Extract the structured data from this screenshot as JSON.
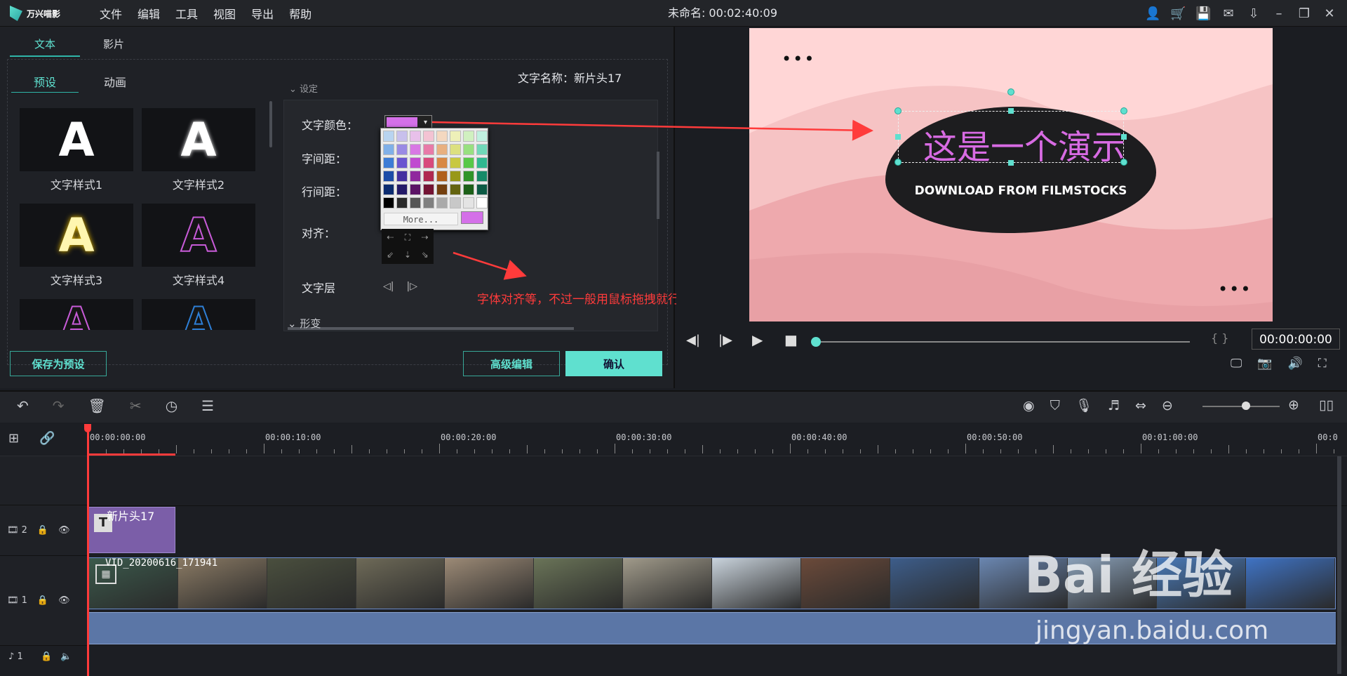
{
  "app": {
    "logo_text": "万兴喵影",
    "menu": [
      "文件",
      "编辑",
      "工具",
      "视图",
      "导出",
      "帮助"
    ],
    "title": "未命名: 00:02:40:09"
  },
  "left_panel": {
    "tabs": [
      "文本",
      "影片"
    ],
    "subtabs": [
      "预设",
      "动画"
    ],
    "text_name_label": "文字名称：新片头17",
    "presets": [
      "文字样式1",
      "文字样式2",
      "文字样式3",
      "文字样式4"
    ],
    "section_top": "设定",
    "section_bottom": "形变",
    "settings": {
      "color_label": "文字颜色：",
      "letter_spacing_label": "字间距：",
      "line_spacing_label": "行间距：",
      "align_label": "对齐：",
      "layer_label": "文字层"
    },
    "palette_more": "More...",
    "selected_color": "#d470e8",
    "annotation": "字体对齐等，不过一般用鼠标拖拽就行",
    "buttons": {
      "save_preset": "保存为预设",
      "advanced_edit": "高级编辑",
      "confirm": "确认"
    }
  },
  "preview": {
    "main_text": "这是一个演示",
    "sub_text": "DOWNLOAD FROM FILMSTOCKS",
    "dots": "•••",
    "time_brace": "{ }",
    "time": "00:00:00:00",
    "progress": 0.0
  },
  "timeline": {
    "ruler_labels": [
      "00:00:00:00",
      "00:00:10:00",
      "00:00:20:00",
      "00:00:30:00",
      "00:00:40:00",
      "00:00:50:00",
      "00:01:00:00",
      "00:0"
    ],
    "tracks": [
      {
        "label": "2",
        "clip": "新片头17"
      },
      {
        "label": "1",
        "clip": "VID_20200616_171941"
      },
      {
        "label": "1"
      }
    ]
  },
  "watermark": {
    "brand": "Bai 经验",
    "url": "jingyan.baidu.com"
  },
  "colors": {
    "accent": "#5fe0cf",
    "annotation": "#ff3b3b",
    "text_pink": "#d86be3"
  }
}
